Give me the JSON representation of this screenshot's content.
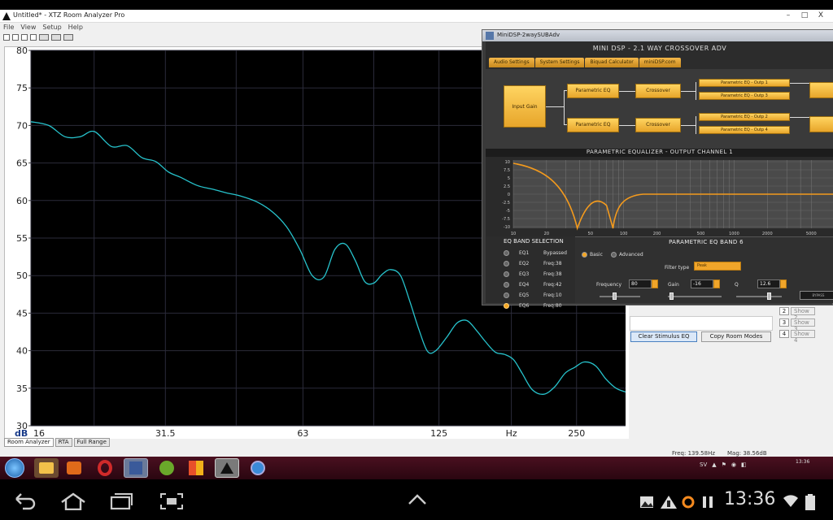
{
  "xtz": {
    "title": "Untitled* - XTZ Room Analyzer Pro",
    "menu": [
      "File",
      "View",
      "Setup",
      "Help"
    ],
    "tabs": [
      "Room Analyzer",
      "RTA",
      "Full Range"
    ],
    "status": {
      "freq": "Freq: 139.58Hz",
      "mag": "Mag: 38.56dB"
    },
    "clear_btn": "Clear Stimulus EQ",
    "copy_btn": "Copy Room Modes",
    "show_rows": [
      {
        "n": "2",
        "label": "Show 2"
      },
      {
        "n": "3",
        "label": "Show 3"
      },
      {
        "n": "4",
        "label": "Show 4"
      }
    ]
  },
  "chart_data": {
    "type": "line",
    "xscale": "log",
    "xlim": [
      16,
      320
    ],
    "ylim": [
      30,
      80
    ],
    "yticks": [
      30,
      35,
      40,
      45,
      50,
      55,
      60,
      65,
      70,
      75,
      80
    ],
    "xticks": [
      {
        "value": 16,
        "label": "16"
      },
      {
        "value": 31.5,
        "label": "31.5"
      },
      {
        "value": 63,
        "label": "63"
      },
      {
        "value": 125,
        "label": "125"
      },
      {
        "value": 250,
        "label": "250"
      }
    ],
    "ylabel": "dB",
    "xlabel": "Hz",
    "grid": true,
    "line_color": "#27c3cc",
    "background": "#000000",
    "series": [
      {
        "x": [
          16,
          17.5,
          19,
          20.5,
          22,
          24,
          26,
          28,
          30,
          32,
          34,
          37,
          40,
          43,
          46,
          50,
          54,
          58,
          62,
          66,
          70,
          74,
          78,
          82,
          86,
          90,
          94,
          98,
          103,
          108,
          113,
          118,
          123,
          130,
          137,
          144,
          151,
          158,
          166,
          174,
          182,
          190,
          200,
          212,
          224,
          236,
          248,
          260,
          275,
          290,
          305,
          320
        ],
        "y": [
          70.5,
          70,
          68.5,
          68.5,
          69.2,
          67.2,
          67.3,
          65.7,
          65.2,
          63.8,
          63.1,
          62.0,
          61.5,
          61.0,
          60.6,
          59.8,
          58.5,
          56.5,
          53.5,
          50.0,
          49.8,
          53.5,
          54.2,
          52.0,
          49.2,
          49.0,
          50.2,
          50.8,
          50.0,
          46.5,
          42.8,
          39.9,
          40.0,
          41.8,
          43.7,
          44.0,
          42.7,
          41.2,
          39.8,
          39.5,
          38.8,
          37.0,
          34.8,
          34.2,
          35.2,
          37.0,
          37.8,
          38.5,
          38.0,
          36.2,
          35.0,
          34.5
        ]
      }
    ]
  },
  "minidsp": {
    "title": "MiniDSP-2waySUBAdv",
    "header": "MINI DSP - 2.1 WAY CROSSOVER ADV",
    "tabs": [
      "Audio Settings",
      "System Settings",
      "Biquad Calculator",
      "miniDSP.com"
    ],
    "blocks": {
      "input_gain": "Input Gain",
      "peq1": "Parametric EQ",
      "peq2": "Parametric EQ",
      "xo1": "Crossover",
      "xo2": "Crossover",
      "outs": [
        "Parametric EQ - Outp 1",
        "Parametric EQ - Outp 3",
        "Parametric EQ - Outp 2",
        "Parametric EQ - Outp 4"
      ]
    },
    "peq_title": "PARAMETRIC EQUALIZER - OUTPUT CHANNEL 1",
    "eq_chart": {
      "yticks": [
        "10",
        "7.5",
        "5",
        "2.5",
        "0",
        "-2.5",
        "-5",
        "-7.5",
        "-10"
      ],
      "xticks": [
        "10",
        "20",
        "50",
        "100",
        "200",
        "500",
        "1000",
        "2000",
        "5000"
      ]
    },
    "band_selection": {
      "heading": "EQ BAND SELECTION",
      "rows": [
        {
          "band": "EQ1",
          "value": "Bypassed",
          "on": false
        },
        {
          "band": "EQ2",
          "value": "Freq:38",
          "on": false
        },
        {
          "band": "EQ3",
          "value": "Freq:38",
          "on": false
        },
        {
          "band": "EQ4",
          "value": "Freq:42",
          "on": false
        },
        {
          "band": "EQ5",
          "value": "Freq:10",
          "on": false
        },
        {
          "band": "EQ6",
          "value": "Freq:80",
          "on": true
        }
      ]
    },
    "band": {
      "title": "PARAMETRIC EQ BAND 6",
      "basic": "Basic",
      "advanced": "Advanced",
      "filter_type_label": "Filter type",
      "filter_type_value": "Peak",
      "frequency_label": "Frequency",
      "frequency_value": "80",
      "gain_label": "Gain",
      "gain_value": "-16",
      "q_label": "Q",
      "q_value": "12.6",
      "bypass": "BYPASS"
    }
  },
  "taskbar": {
    "tray_text": "SV",
    "clock_small": "13:36"
  },
  "android": {
    "time": "13:36"
  }
}
